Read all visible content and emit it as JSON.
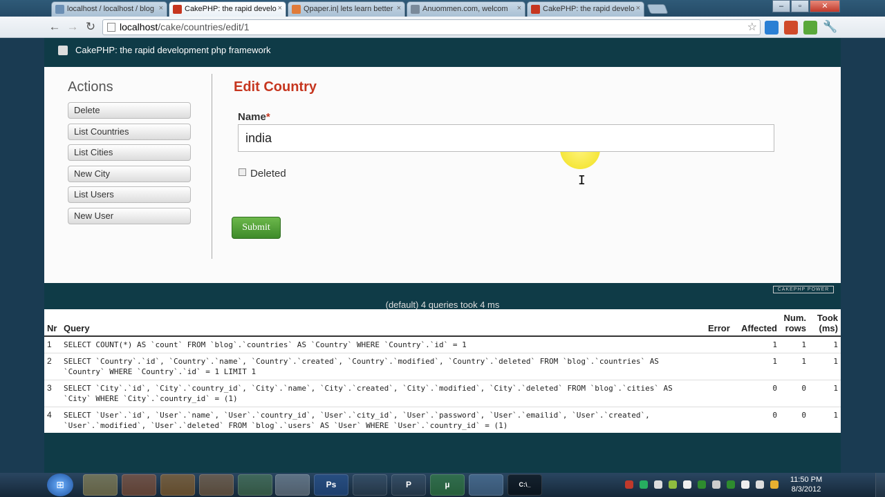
{
  "browser": {
    "tabs": [
      {
        "title": "localhost / localhost / blog",
        "active": false
      },
      {
        "title": "CakePHP: the rapid develo",
        "active": true
      },
      {
        "title": "Qpaper.in| lets learn better",
        "active": false
      },
      {
        "title": "Anuommen.com, welcom",
        "active": false
      },
      {
        "title": "CakePHP: the rapid develo",
        "active": false
      }
    ],
    "close_glyph": "×",
    "url_host": "localhost",
    "url_path": "/cake/countries/edit/1"
  },
  "page": {
    "header_title": "CakePHP: the rapid development php framework",
    "actions_title": "Actions",
    "actions": [
      "Delete",
      "List Countries",
      "List Cities",
      "New City",
      "List Users",
      "New User"
    ],
    "form_title": "Edit Country",
    "name_label": "Name",
    "required_mark": "*",
    "name_value": "india",
    "deleted_label": "Deleted",
    "submit_label": "Submit"
  },
  "sql_log": {
    "powered_label": "CAKEPHP POWER",
    "caption": "(default) 4 queries took 4 ms",
    "columns": [
      "Nr",
      "Query",
      "Error",
      "Affected",
      "Num. rows",
      "Took (ms)"
    ],
    "rows": [
      {
        "nr": "1",
        "query": "SELECT COUNT(*) AS `count` FROM `blog`.`countries` AS `Country` WHERE `Country`.`id` = 1",
        "error": "",
        "affected": "1",
        "num_rows": "1",
        "took": "1"
      },
      {
        "nr": "2",
        "query": "SELECT `Country`.`id`, `Country`.`name`, `Country`.`created`, `Country`.`modified`, `Country`.`deleted` FROM `blog`.`countries` AS `Country` WHERE `Country`.`id` = 1 LIMIT 1",
        "error": "",
        "affected": "1",
        "num_rows": "1",
        "took": "1"
      },
      {
        "nr": "3",
        "query": "SELECT `City`.`id`, `City`.`country_id`, `City`.`name`, `City`.`created`, `City`.`modified`, `City`.`deleted` FROM `blog`.`cities` AS `City` WHERE `City`.`country_id` = (1)",
        "error": "",
        "affected": "0",
        "num_rows": "0",
        "took": "1"
      },
      {
        "nr": "4",
        "query": "SELECT `User`.`id`, `User`.`name`, `User`.`country_id`, `User`.`city_id`, `User`.`password`, `User`.`emailid`, `User`.`created`, `User`.`modified`, `User`.`deleted` FROM `blog`.`users` AS `User` WHERE `User`.`country_id` = (1)",
        "error": "",
        "affected": "0",
        "num_rows": "0",
        "took": "1"
      }
    ]
  },
  "taskbar": {
    "tasks": [
      "",
      "",
      "",
      "",
      "",
      "",
      "Ps",
      "",
      "P",
      "µ",
      "",
      "C:\\_"
    ],
    "clock_time": "11:50 PM",
    "clock_date": "8/3/2012"
  },
  "colors": {
    "header_bg": "#0f3b47",
    "title_red": "#c6361f",
    "submit_green": "#4a9a35"
  }
}
